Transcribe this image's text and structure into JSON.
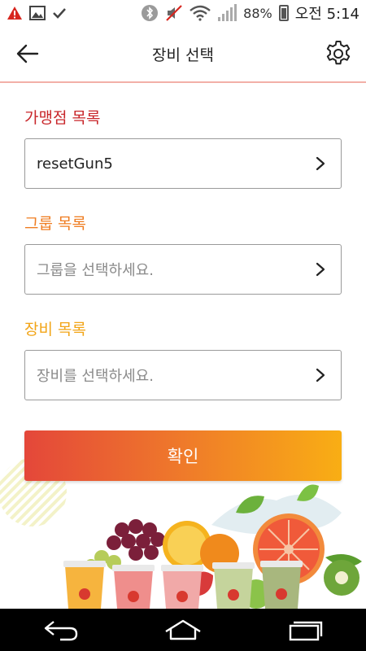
{
  "status_bar": {
    "battery": "88%",
    "clock": "오전 5:14"
  },
  "header": {
    "title": "장비 선택"
  },
  "form": {
    "store_label": "가맹점 목록",
    "store_value": "resetGun5",
    "group_label": "그룹 목록",
    "group_placeholder": "그룹을 선택하세요.",
    "device_label": "장비 목록",
    "device_placeholder": "장비를 선택하세요.",
    "confirm_label": "확인"
  },
  "colors": {
    "store_label": "#c8262a",
    "group_label": "#ef7d22",
    "device_label": "#f2a416",
    "gradient_start": "#e4473a",
    "gradient_end": "#f9ae14"
  },
  "icons": [
    "warning-icon",
    "image-icon",
    "check-icon",
    "bluetooth-icon",
    "mute-icon",
    "wifi-icon",
    "signal-icon",
    "battery-icon",
    "back-arrow-icon",
    "gear-icon",
    "chevron-right-icon",
    "nav-back-icon",
    "nav-home-icon",
    "nav-recents-icon"
  ]
}
